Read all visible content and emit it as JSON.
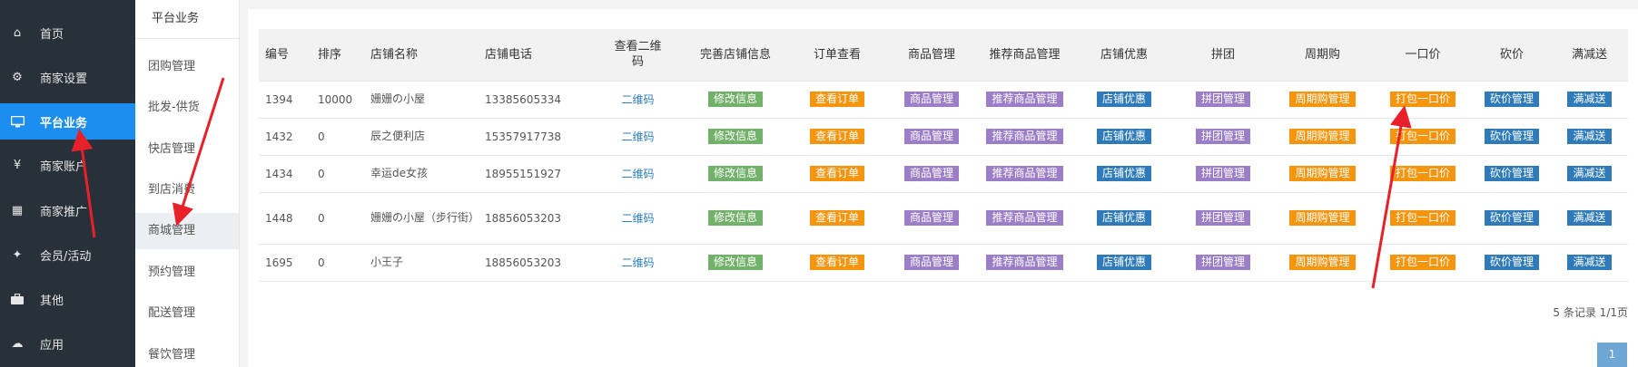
{
  "sidebar": {
    "items": [
      {
        "label": "首页",
        "icon": "home-icon",
        "glyph": "⌂"
      },
      {
        "label": "商家设置",
        "icon": "gear-icon",
        "glyph": "⚙"
      },
      {
        "label": "平台业务",
        "icon": "monitor-icon",
        "glyph": "▭",
        "active": true
      },
      {
        "label": "商家账户",
        "icon": "yen-icon",
        "glyph": "¥"
      },
      {
        "label": "商家推广",
        "icon": "qrcode-icon",
        "glyph": "▦"
      },
      {
        "label": "会员/活动",
        "icon": "wand-icon",
        "glyph": "✦"
      },
      {
        "label": "其他",
        "icon": "briefcase-icon",
        "glyph": "▬"
      },
      {
        "label": "应用",
        "icon": "cloud-download-icon",
        "glyph": "☁"
      }
    ]
  },
  "submenu": {
    "title": "平台业务",
    "items": [
      {
        "label": "团购管理"
      },
      {
        "label": "批发-供货"
      },
      {
        "label": "快店管理"
      },
      {
        "label": "到店消费"
      },
      {
        "label": "商城管理",
        "active": true
      },
      {
        "label": "预约管理"
      },
      {
        "label": "配送管理"
      },
      {
        "label": "餐饮管理"
      }
    ]
  },
  "table": {
    "headers": {
      "id": "编号",
      "sort": "排序",
      "name": "店铺名称",
      "phone": "店铺电话",
      "qr_line1": "查看二维",
      "qr_line2": "码",
      "info": "完善店铺信息",
      "orders": "订单查看",
      "goods": "商品管理",
      "recommend": "推荐商品管理",
      "coupon": "店铺优惠",
      "group": "拼团",
      "period": "周期购",
      "fixed": "一口价",
      "bargain": "砍价",
      "discount": "满减送"
    },
    "actions": {
      "qr": "二维码",
      "info": "修改信息",
      "orders": "查看订单",
      "goods": "商品管理",
      "recommend": "推荐商品管理",
      "coupon": "店铺优惠",
      "group": "拼团管理",
      "period": "周期购管理",
      "fixed": "打包一口价",
      "bargain": "砍价管理",
      "discount": "满减送"
    },
    "rows": [
      {
        "id": "1394",
        "sort": "10000",
        "name": "姗姗の小屋",
        "phone": "13385605334"
      },
      {
        "id": "1432",
        "sort": "0",
        "name": "辰之便利店",
        "phone": "15357917738"
      },
      {
        "id": "1434",
        "sort": "0",
        "name": "幸运de女孩",
        "phone": "18955151927"
      },
      {
        "id": "1448",
        "sort": "0",
        "name": "姗姗の小屋（步行街）",
        "phone": "18856053203"
      },
      {
        "id": "1695",
        "sort": "0",
        "name": "小王子",
        "phone": "18856053203"
      }
    ]
  },
  "pager": {
    "summary": "5 条记录 1/1页",
    "current_page": "1"
  },
  "colors": {
    "sidebar_bg": "#283039",
    "active_blue": "#1c8ef0",
    "btn_green": "#72b16a",
    "btn_orange": "#f5950e",
    "btn_purple": "#9b7ec7",
    "btn_blue": "#2f7bb9",
    "arrow_red": "#e8202a"
  }
}
